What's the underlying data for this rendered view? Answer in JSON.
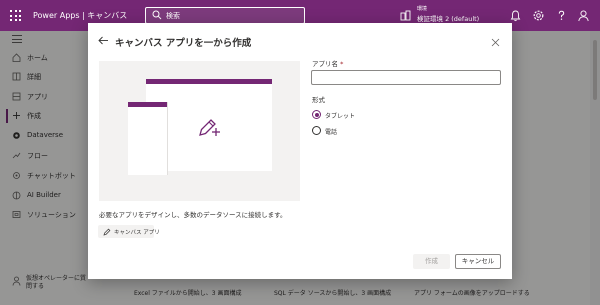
{
  "topbar": {
    "app_title": "Power Apps | キャンバス",
    "search_placeholder": "検索",
    "env_label": "環境",
    "env_name": "検証環境 2 (default)"
  },
  "nav": {
    "items": [
      {
        "label": "ホーム",
        "icon": "home-icon"
      },
      {
        "label": "詳細",
        "icon": "detail-icon"
      },
      {
        "label": "アプリ",
        "icon": "apps-icon"
      },
      {
        "label": "作成",
        "icon": "plus-icon"
      },
      {
        "label": "Dataverse",
        "icon": "dataverse-icon"
      },
      {
        "label": "フロー",
        "icon": "flow-icon"
      },
      {
        "label": "チャットボット",
        "icon": "chatbot-icon"
      },
      {
        "label": "AI Builder",
        "icon": "ai-builder-icon"
      },
      {
        "label": "ソリューション",
        "icon": "solutions-icon"
      }
    ],
    "bottom_label": "仮想オペレーターに質問する"
  },
  "background": {
    "bottom_left": "Excel ファイルから開始し、3 画面構成",
    "bottom_mid": "SQL データ ソースから開始し、3 画面構成",
    "bottom_right": "アプリ フォームの画像をアップロードする"
  },
  "dialog": {
    "title": "キャンバス アプリを一から作成",
    "description": "必要なアプリをデザインし、多数のデータソースに接続します。",
    "tag": "キャンバス アプリ",
    "name_label": "アプリ名",
    "name_required": "*",
    "name_value": "",
    "format_label": "形式",
    "format_options": [
      {
        "label": "タブレット",
        "checked": true
      },
      {
        "label": "電話",
        "checked": false
      }
    ],
    "create_label": "作成",
    "cancel_label": "キャンセル"
  },
  "colors": {
    "brand": "#742774",
    "error": "#a4262c"
  }
}
